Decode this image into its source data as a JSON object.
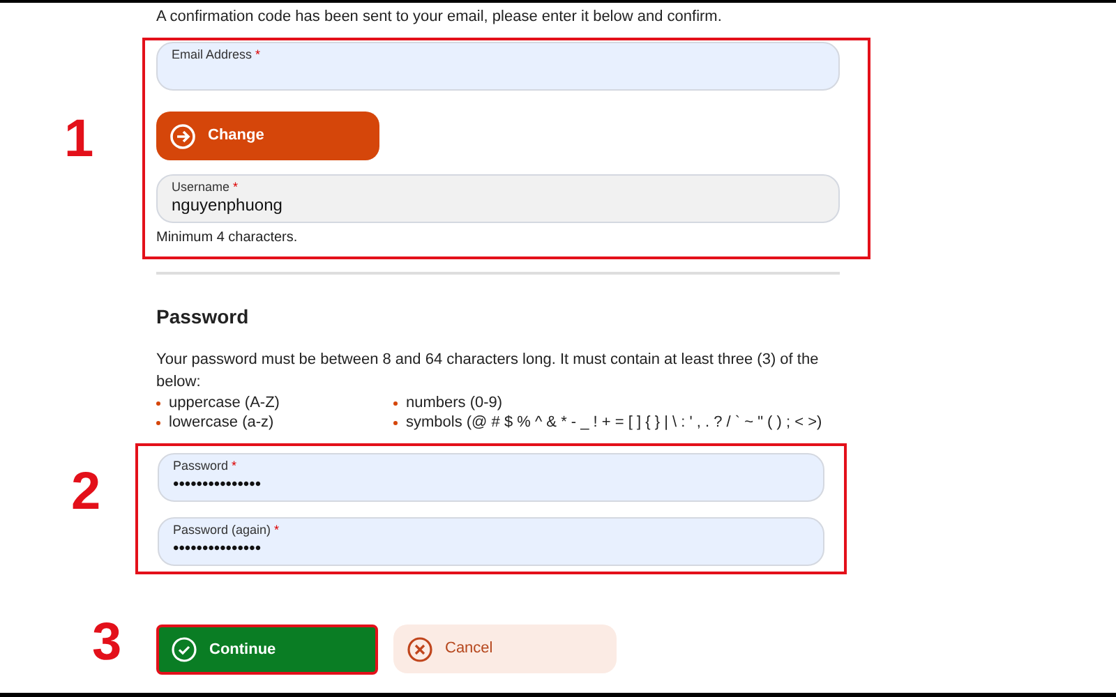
{
  "intro": "A confirmation code has been sent to your email, please enter it below and confirm.",
  "account": {
    "annotation": "1",
    "email": {
      "label": "Email Address",
      "required_mark": "*"
    },
    "change_button": "Change",
    "username": {
      "label": "Username",
      "required_mark": "*",
      "value": "nguyenphuong"
    },
    "hint": "Minimum 4 characters."
  },
  "password_section": {
    "title": "Password",
    "description": "Your password must be between 8 and 64 characters long. It must contain at least three (3) of the below:",
    "rules": [
      [
        "uppercase (A-Z)",
        "lowercase (a-z)"
      ],
      [
        "numbers (0-9)",
        "symbols (@ # $ % ^ & * - _ ! + = [ ] { } | \\ : ' , . ? / ` ~ \" ( ) ; < >)"
      ]
    ],
    "annotation": "2",
    "fields": [
      {
        "label": "Password",
        "required_mark": "*",
        "value": "•••••••••••••••"
      },
      {
        "label": "Password (again)",
        "required_mark": "*",
        "value": "•••••••••••••••"
      }
    ]
  },
  "actions": {
    "annotation": "3",
    "continue": "Continue",
    "cancel": "Cancel"
  }
}
